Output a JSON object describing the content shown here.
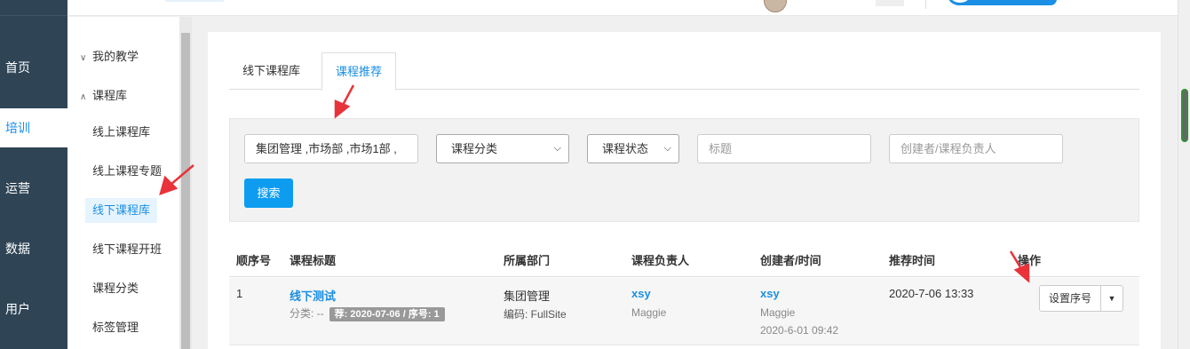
{
  "leftnav": {
    "items": [
      {
        "label": "首页"
      },
      {
        "label": "培训"
      },
      {
        "label": "运营"
      },
      {
        "label": "数据"
      },
      {
        "label": "用户"
      }
    ]
  },
  "submenu": {
    "groups": [
      {
        "label": "我的教学",
        "chevron": "v"
      },
      {
        "label": "课程库",
        "chevron": "^"
      }
    ],
    "items": [
      {
        "label": "线上课程库"
      },
      {
        "label": "线上课程专题"
      },
      {
        "label": "线下课程库"
      },
      {
        "label": "线下课程开班"
      },
      {
        "label": "课程分类"
      },
      {
        "label": "标签管理"
      }
    ]
  },
  "tabs": [
    {
      "label": "线下课程库"
    },
    {
      "label": "课程推荐"
    }
  ],
  "filter": {
    "department_value": "集团管理 ,市场部 ,市场1部 ,",
    "category_value": "课程分类",
    "status_value": "课程状态",
    "title_placeholder": "标题",
    "creator_placeholder": "创建者/课程负责人",
    "search_label": "搜索"
  },
  "table": {
    "headers": [
      "顺序号",
      "课程标题",
      "所属部门",
      "课程负责人",
      "创建者/时间",
      "推荐时间",
      "操作"
    ],
    "rows": [
      {
        "order": "1",
        "title": "线下测试",
        "category": "分类: --",
        "recommend_badge": "荐: 2020-07-06 / 序号: 1",
        "department": "集团管理",
        "code": "编码: FullSite",
        "owner": "xsy",
        "owner_name": "Maggie",
        "creator": "xsy",
        "creator_name": "Maggie",
        "created_time": "2020-6-01 09:42",
        "recommend_time": "2020-7-06 13:33",
        "action_label": "设置序号"
      }
    ]
  },
  "colors": {
    "accent": "#1a8fe3",
    "nav_bg": "#2f4556",
    "arrow": "#e8333a"
  }
}
